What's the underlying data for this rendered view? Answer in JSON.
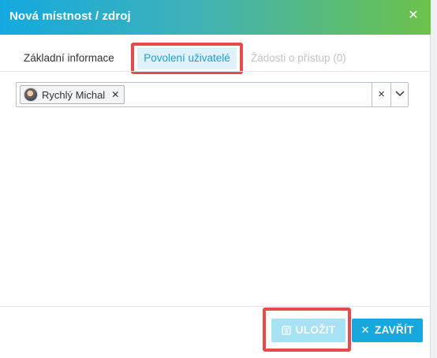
{
  "dialog": {
    "title": "Nová místnost / zdroj",
    "close_icon": "close-icon"
  },
  "tabs": [
    {
      "label": "Základní informace",
      "active": false
    },
    {
      "label": "Povolení uživatelé",
      "active": true
    },
    {
      "label": "Žádosti o přístup  (0)",
      "active": false,
      "disabled": true
    }
  ],
  "users_select": {
    "selected": [
      {
        "name": "Rychlý Michal",
        "avatar_icon": "user-avatar-icon"
      }
    ],
    "clear_symbol": "×",
    "dropdown_icon": "chevron-down-icon"
  },
  "footer": {
    "save_label": "ULOŽIT",
    "save_icon": "save-icon",
    "close_label": "ZAVŘÍT",
    "close_icon": "close-icon"
  },
  "colors": {
    "header_gradient_start": "#13a9e0",
    "header_gradient_end": "#6cc24a",
    "accent": "#18a7dd",
    "highlight": "#e54b4b",
    "save_disabled": "#a6e1f4"
  }
}
